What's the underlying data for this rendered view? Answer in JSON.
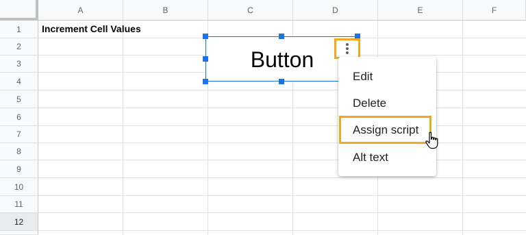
{
  "sheet": {
    "columns": [
      "A",
      "B",
      "C",
      "D",
      "E",
      "F"
    ],
    "rows": [
      "1",
      "2",
      "3",
      "4",
      "5",
      "6",
      "7",
      "8",
      "9",
      "10",
      "11",
      "12"
    ],
    "selected_row": "12",
    "cell_a1": "Increment Cell Values"
  },
  "drawing": {
    "label": "Button",
    "more_options_icon": "more-vertical-icon"
  },
  "context_menu": {
    "items": [
      "Edit",
      "Delete",
      "Assign script",
      "Alt text"
    ],
    "highlighted": "Assign script"
  },
  "pointer": "hand-pointer-icon",
  "colors": {
    "accent_blue": "#1a73e8",
    "highlight_orange": "#f4a81d",
    "header_bg": "#f8f9fa",
    "grid": "#e2e2e2"
  }
}
